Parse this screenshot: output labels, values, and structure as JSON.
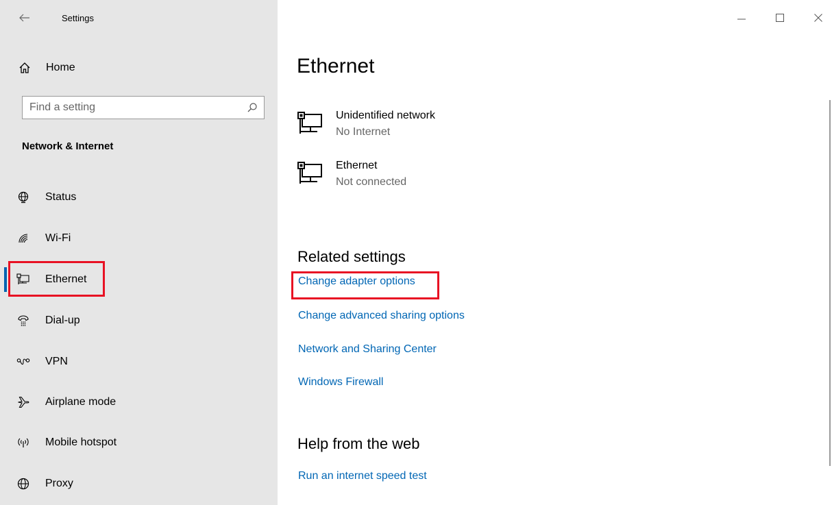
{
  "window": {
    "title": "Settings",
    "controls": [
      "minimize-icon",
      "maximize-icon",
      "close-icon"
    ]
  },
  "sidebar": {
    "home_label": "Home",
    "search_placeholder": "Find a setting",
    "section_title": "Network & Internet",
    "items": [
      {
        "label": "Status",
        "icon": "globe-status-icon"
      },
      {
        "label": "Wi-Fi",
        "icon": "wifi-icon"
      },
      {
        "label": "Ethernet",
        "icon": "ethernet-icon",
        "selected": true
      },
      {
        "label": "Dial-up",
        "icon": "dialup-icon"
      },
      {
        "label": "VPN",
        "icon": "vpn-icon"
      },
      {
        "label": "Airplane mode",
        "icon": "airplane-icon"
      },
      {
        "label": "Mobile hotspot",
        "icon": "hotspot-icon"
      },
      {
        "label": "Proxy",
        "icon": "globe-icon"
      }
    ]
  },
  "main": {
    "title": "Ethernet",
    "networks": [
      {
        "name": "Unidentified network",
        "status": "No Internet",
        "icon": "ethernet-icon"
      },
      {
        "name": "Ethernet",
        "status": "Not connected",
        "icon": "ethernet-icon"
      }
    ],
    "related_heading": "Related settings",
    "related_links": [
      "Change adapter options",
      "Change advanced sharing options",
      "Network and Sharing Center",
      "Windows Firewall"
    ],
    "help_heading": "Help from the web",
    "help_links": [
      "Run an internet speed test"
    ]
  },
  "colors": {
    "sidebar_bg": "#e6e6e6",
    "link": "#0066b4",
    "accent": "#0063b1",
    "highlight": "#e81123"
  }
}
